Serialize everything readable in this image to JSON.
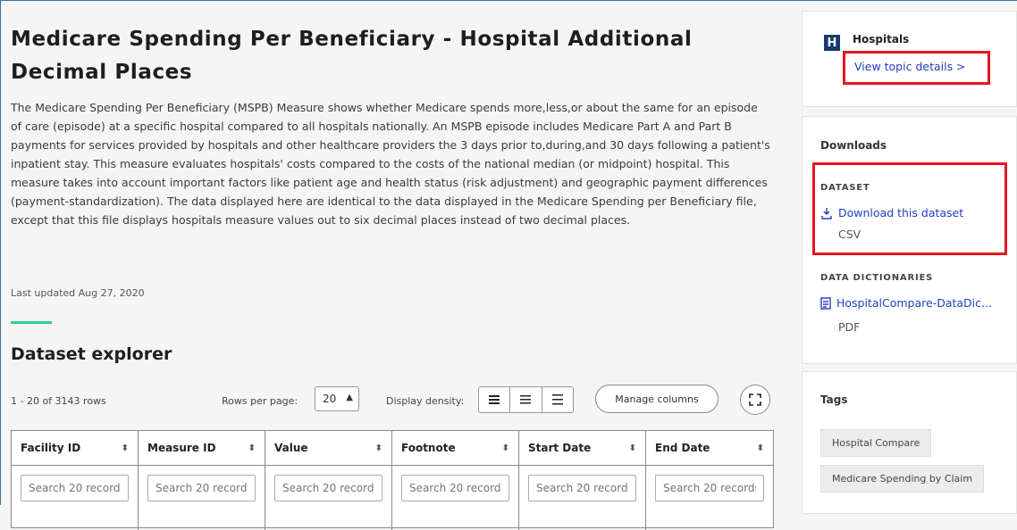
{
  "main": {
    "title": "Medicare Spending Per Beneficiary - Hospital Additional Decimal Places",
    "description": "The Medicare Spending Per Beneficiary (MSPB) Measure shows whether Medicare spends more,less,or about the same for an episode of care (episode) at a specific hospital compared to all hospitals nationally. An MSPB episode includes Medicare Part A and Part B payments for services provided by hospitals and other healthcare providers the 3 days prior to,during,and 30 days following a patient's inpatient stay. This measure evaluates hospitals' costs compared to the costs of the national median (or midpoint) hospital. This measure takes into account important factors like patient age and health status (risk adjustment) and geographic payment differences (payment-standardization). The data displayed here are identical to the data displayed in the Medicare Spending per Beneficiary file, except that this file displays hospitals measure values out to six decimal places instead of two decimal places.",
    "last_updated": "Last updated Aug 27, 2020"
  },
  "explorer": {
    "title": "Dataset explorer",
    "rows_count": "1 - 20 of 3143 rows",
    "rows_per_page_label": "Rows per page:",
    "rows_per_page_value": "20",
    "density_label": "Display density:",
    "manage_columns": "Manage columns",
    "columns": [
      "Facility ID",
      "Measure ID",
      "Value",
      "Footnote",
      "Start Date",
      "End Date"
    ],
    "filter_placeholder": "Search 20 records"
  },
  "sidebar": {
    "topic": {
      "logo_letter": "H",
      "title": "Hospitals",
      "link": "View topic details >"
    },
    "downloads": {
      "title": "Downloads",
      "dataset_label": "DATASET",
      "dataset_link": "Download this dataset",
      "dataset_format": "CSV",
      "dictionaries_label": "DATA DICTIONARIES",
      "dictionary_link": "HospitalCompare-DataDic...",
      "dictionary_format": "PDF"
    },
    "tags": {
      "title": "Tags",
      "items": [
        "Hospital Compare",
        "Medicare Spending by Claim"
      ]
    }
  },
  "colors": {
    "link": "#2040c0",
    "highlight": "#e4151f",
    "accent_green": "#2fd08a",
    "logo_bg": "#1a3a6b"
  }
}
